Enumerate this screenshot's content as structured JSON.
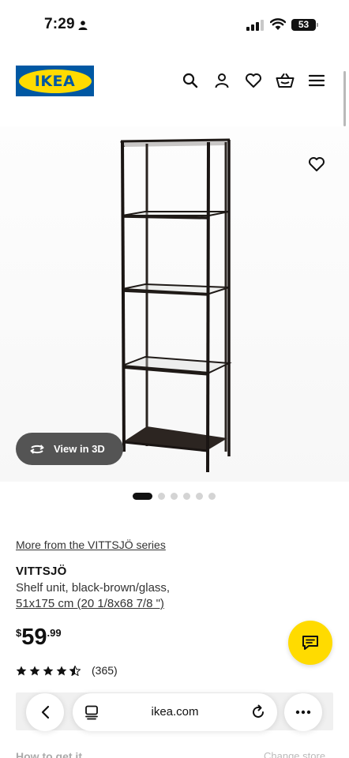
{
  "status_bar": {
    "time": "7:29",
    "battery": "53"
  },
  "header": {
    "logo_text": "IKEA",
    "icons": [
      "search-icon",
      "account-icon",
      "heart-icon",
      "basket-icon",
      "menu-icon"
    ]
  },
  "gallery": {
    "view_3d_label": "View in 3D",
    "slide_count": 6,
    "active_slide": 1
  },
  "product": {
    "series_link": "More from the VITTSJÖ series",
    "name": "VITTSJÖ",
    "description": "Shelf unit, black-brown/glass,",
    "size": "51x175 cm (20 1/8x68 7/8 \")",
    "price": {
      "currency": "$",
      "integer": "59",
      "decimal": ".99"
    },
    "rating": {
      "stars": 4.5,
      "count": "(365)"
    }
  },
  "below": {
    "how_to_get": "How to get it",
    "change_store": "Change store"
  },
  "browser": {
    "url": "ikea.com"
  },
  "colors": {
    "ikea_blue": "#0058a3",
    "ikea_yellow": "#ffdb00"
  }
}
